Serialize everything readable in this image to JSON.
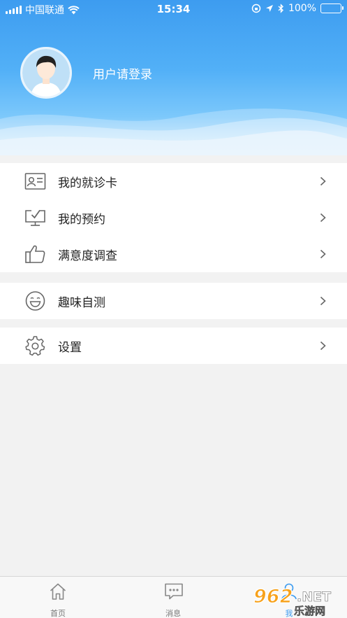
{
  "status_bar": {
    "carrier": "中国联通",
    "time": "15:34",
    "battery": "100%"
  },
  "profile": {
    "login_prompt": "用户请登录"
  },
  "menu": {
    "group1": [
      {
        "label": "我的就诊卡",
        "icon": "id-card-icon"
      },
      {
        "label": "我的预约",
        "icon": "monitor-check-icon"
      },
      {
        "label": "满意度调查",
        "icon": "thumbs-up-icon"
      }
    ],
    "group2": [
      {
        "label": "趣味自测",
        "icon": "smile-face-icon"
      }
    ],
    "group3": [
      {
        "label": "设置",
        "icon": "gear-icon"
      }
    ]
  },
  "tabbar": {
    "tabs": [
      {
        "label": "首页",
        "icon": "home-icon"
      },
      {
        "label": "消息",
        "icon": "message-icon"
      },
      {
        "label": "我",
        "icon": "user-icon"
      }
    ]
  },
  "watermark": {
    "number": "962",
    "suffix": ".NET",
    "cn": "乐游网"
  },
  "colors": {
    "header_top": "#3d9cf0",
    "header_bottom": "#d6ecfb",
    "icon_gray": "#666666",
    "background": "#f2f2f2"
  }
}
